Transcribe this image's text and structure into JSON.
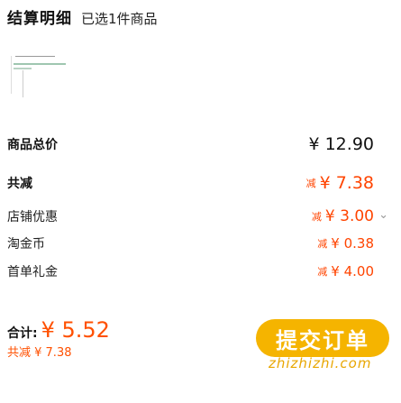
{
  "header": {
    "title": "结算明细",
    "subtitle": "已选1件商品"
  },
  "rows": [
    {
      "label": "商品总价",
      "prefix": "",
      "value": "¥ 12.90"
    },
    {
      "label": "共减",
      "prefix": "减",
      "value": "¥ 7.38"
    },
    {
      "label": "店铺优惠",
      "prefix": "减",
      "value": "¥ 3.00"
    },
    {
      "label": "淘金币",
      "prefix": "减",
      "value": "¥ 0.38"
    },
    {
      "label": "首单礼金",
      "prefix": "减",
      "value": "¥ 4.00"
    }
  ],
  "footer": {
    "total_label": "合计:",
    "total_value": "¥ 5.52",
    "saved_text": "共减 ¥ 7.38",
    "submit_label": "提交订单"
  },
  "watermark": "zhizhizhi.com",
  "icons": {
    "expand": "chevron-down-icon"
  },
  "colors": {
    "accent": "#ff5000",
    "button": "#f5b400"
  }
}
